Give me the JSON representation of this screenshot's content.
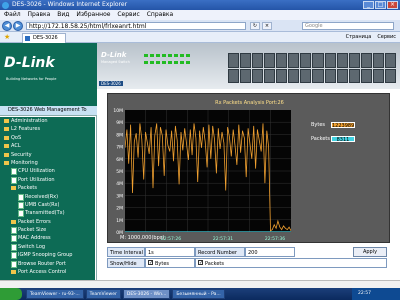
{
  "window": {
    "title": "DES-3026 - Windows Internet Explorer"
  },
  "menu": [
    "Файл",
    "Правка",
    "Вид",
    "Избранное",
    "Сервис",
    "Справка"
  ],
  "address": {
    "url": "http://172.18.58.25/html/frlxeanrt.html",
    "search_placeholder": "Google"
  },
  "tab": {
    "label": "DES-3026"
  },
  "toolbar_right": [
    "Страница",
    "Сервис"
  ],
  "brand": {
    "logo": "D-Link",
    "tagline": "Building Networks for People",
    "device_logo": "D-Link",
    "device_sub": "Managed Switch",
    "model": "DES-3026"
  },
  "nav": {
    "header": "DES-3026 Web Management To",
    "items": [
      {
        "label": "Administration",
        "type": "folder",
        "indent": 1
      },
      {
        "label": "L2 Features",
        "type": "folder",
        "indent": 1
      },
      {
        "label": "QoS",
        "type": "folder",
        "indent": 1
      },
      {
        "label": "ACL",
        "type": "folder",
        "indent": 1
      },
      {
        "label": "Security",
        "type": "folder",
        "indent": 1
      },
      {
        "label": "Monitoring",
        "type": "folder",
        "indent": 1
      },
      {
        "label": "CPU Utilization",
        "type": "doc",
        "indent": 2
      },
      {
        "label": "Port Utilization",
        "type": "doc",
        "indent": 2
      },
      {
        "label": "Packets",
        "type": "folder",
        "indent": 2
      },
      {
        "label": "Received(Rx)",
        "type": "doc",
        "indent": 3
      },
      {
        "label": "UMB Cast(Rx)",
        "type": "doc",
        "indent": 3
      },
      {
        "label": "Transmitted(Tx)",
        "type": "doc",
        "indent": 3
      },
      {
        "label": "Packet Errors",
        "type": "folder",
        "indent": 2
      },
      {
        "label": "Packet Size",
        "type": "doc",
        "indent": 2
      },
      {
        "label": "MAC Address",
        "type": "doc",
        "indent": 2
      },
      {
        "label": "Switch Log",
        "type": "doc",
        "indent": 2
      },
      {
        "label": "IGMP Snooping Group",
        "type": "doc",
        "indent": 2
      },
      {
        "label": "Browse Router Port",
        "type": "doc",
        "indent": 2
      },
      {
        "label": "Port Access Control",
        "type": "folder",
        "indent": 2
      }
    ]
  },
  "chart": {
    "title": "Rx Packets Analysis  Port:26",
    "y_ticks": [
      "10M",
      "9M",
      "8M",
      "7M",
      "6M",
      "5M",
      "4M",
      "3M",
      "2M",
      "1M",
      "0M"
    ],
    "x_ticks": [
      "22:57:26",
      "22:57:31",
      "22:57:36"
    ],
    "bytes_label": "Bytes",
    "bytes_value": "1223989",
    "packets_label": "Packets",
    "packets_value": "8311",
    "footnote": "M: 1000,000(bps)",
    "bytes_color": "#f0a030",
    "packets_color": "#40d0e0"
  },
  "chart_data": {
    "type": "line",
    "ylim": [
      0,
      10
    ],
    "ylabel": "M",
    "series": [
      {
        "name": "Bytes",
        "values": [
          6.9,
          8.4,
          5.6,
          8.8,
          3.2,
          7.4,
          8.1,
          6.1,
          8.9,
          7.6,
          4.3,
          8.2,
          7.3,
          6.4,
          8.6,
          3.6,
          7.9,
          8.9,
          5.4,
          8.6,
          7.9,
          4.6,
          8.4,
          7.1,
          6.6,
          8.3,
          5.8,
          8.7,
          7.5,
          3.9,
          8.2,
          6.7,
          8.5,
          7.2,
          5.9,
          8.4,
          6.3,
          8.9,
          7.7,
          4.1,
          8.3,
          6.9,
          8.6,
          7.4,
          5.3,
          8.8,
          6.0,
          8.7,
          7.6,
          4.8,
          8.5,
          6.8,
          8.2,
          7.3,
          3.4,
          8.6,
          7.8,
          6.2,
          8.4,
          7.1,
          5.5,
          8.8,
          6.5,
          8.3,
          7.7,
          4.5,
          8.5,
          7.2,
          6.0,
          8.7,
          5.2,
          8.4,
          7.5,
          6.6,
          8.9,
          4.0,
          8.3,
          7.0,
          0.1,
          0.2,
          0.6,
          0.3,
          0.9,
          0.4,
          0.2,
          0.5,
          0.3,
          0.2,
          0.4,
          0.1
        ]
      },
      {
        "name": "Packets",
        "values": [
          0.02,
          0.02,
          0.02,
          0.02,
          0.02,
          0.02,
          0.02,
          0.02,
          0.02,
          0.02,
          0.02,
          0.02
        ]
      }
    ]
  },
  "controls": {
    "time_interval_label": "Time Interval",
    "time_interval_value": "1s",
    "record_number_label": "Record Number",
    "record_number_value": "200",
    "apply_label": "Apply",
    "show_hide_label": "Show/Hide",
    "bytes_label": "Bytes",
    "packets_label": "Packets"
  },
  "taskbar": {
    "start": "",
    "tasks": [
      "TeamViewer - ru-93-...",
      "TeamViewer",
      "DES-3026 - Win...",
      "Безымянный - Pa..."
    ],
    "clock": "22:57"
  }
}
